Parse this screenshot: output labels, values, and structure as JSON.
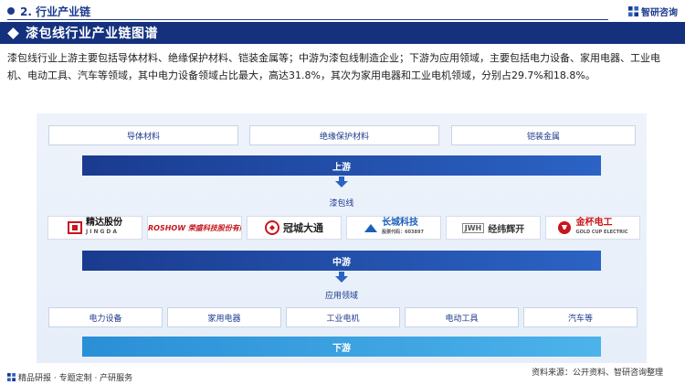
{
  "header": {
    "section_title": "2. 行业产业链",
    "brand": "智研咨询"
  },
  "title": "漆包线行业产业链图谱",
  "intro": "漆包线行业上游主要包括导体材料、绝缘保护材料、铠装金属等；中游为漆包线制造企业；下游为应用领域，主要包括电力设备、家用电器、工业电机、电动工具、汽车等领域，其中电力设备领域占比最大，高达31.8%，其次为家用电器和工业电机领域，分别占29.7%和18.8%。",
  "upstream": {
    "items": [
      "导体材料",
      "绝缘保护材料",
      "铠装金属"
    ],
    "band_label": "上游"
  },
  "midstream": {
    "label": "漆包线",
    "logos": [
      {
        "name": "精达股份",
        "sub": "JINGDA",
        "color": "#c8161d",
        "icon": "jingda-logo"
      },
      {
        "name": "ROSHOW 荣盛科技股份有限公司",
        "color": "#c8161d",
        "icon": "roshow-logo"
      },
      {
        "name": "冠城大通",
        "color": "#c8161d",
        "icon": "guancheng-logo"
      },
      {
        "name": "长城科技",
        "sub": "股票代码：603897",
        "color": "#1b5fb8",
        "icon": "changcheng-logo"
      },
      {
        "name": "经纬辉开",
        "sub": "JWH",
        "color": "#555555",
        "icon": "jingwei-logo"
      },
      {
        "name": "金杯电工",
        "sub": "GOLD CUP ELECTRIC",
        "color": "#c8161d",
        "icon": "jinbei-logo"
      }
    ],
    "band_label": "中游"
  },
  "downstream": {
    "label": "应用领域",
    "items": [
      "电力设备",
      "家用电器",
      "工业电机",
      "电动工具",
      "汽车等"
    ],
    "band_label": "下游"
  },
  "footer": {
    "left": "精品研报 · 专题定制 · 产研服务",
    "right": "资料来源：公开资料、智研咨询整理"
  },
  "colors": {
    "primary": "#15317e",
    "accent": "#2b63c4",
    "light_band": "#4cb3ea"
  }
}
